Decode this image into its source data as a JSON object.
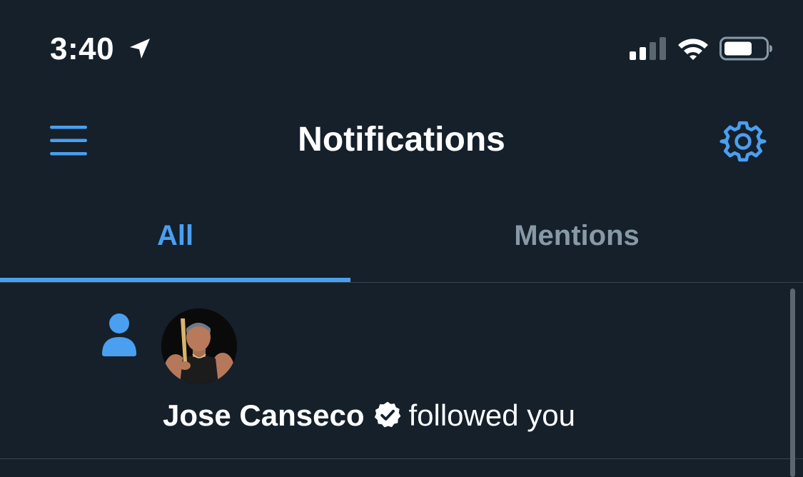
{
  "status_bar": {
    "time": "3:40",
    "location_icon": "location-arrow-icon",
    "signal_icon": "cellular-signal-icon",
    "wifi_icon": "wifi-icon",
    "battery_icon": "battery-icon"
  },
  "header": {
    "title": "Notifications",
    "menu_icon": "hamburger-menu-icon",
    "settings_icon": "gear-icon"
  },
  "tabs": [
    {
      "label": "All",
      "selected": true
    },
    {
      "label": "Mentions",
      "selected": false
    }
  ],
  "notifications": [
    {
      "type_icon": "person-icon",
      "user_name": "Jose Canseco",
      "verified": true,
      "action": "followed you"
    }
  ],
  "colors": {
    "background": "#15202b",
    "accent": "#4a9ff0",
    "inactive_tab": "#8899a6",
    "divider": "#38444d",
    "text": "#ffffff"
  }
}
